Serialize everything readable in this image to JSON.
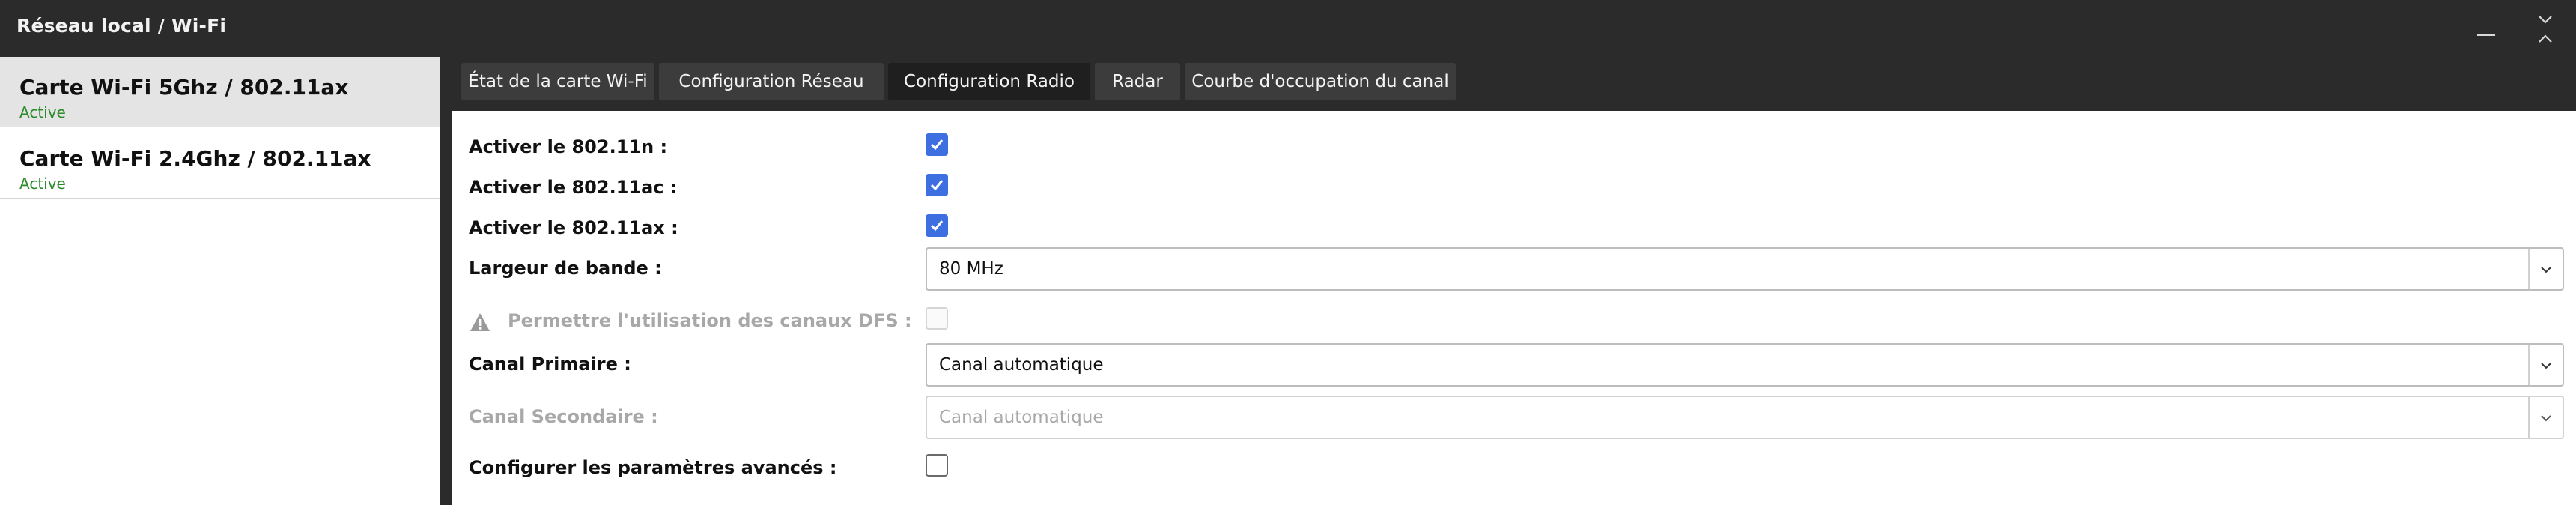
{
  "window": {
    "title": "Réseau local / Wi-Fi",
    "minimize_icon": "minimize-icon",
    "collapse_icon": "collapse-chevrons-icon"
  },
  "sidebar": {
    "items": [
      {
        "name": "Carte Wi-Fi 5Ghz / 802.11ax",
        "status": "Active",
        "selected": true
      },
      {
        "name": "Carte Wi-Fi 2.4Ghz / 802.11ax",
        "status": "Active",
        "selected": false
      }
    ]
  },
  "tabs": [
    {
      "label": "État de la carte Wi-Fi",
      "active": false
    },
    {
      "label": "Configuration Réseau",
      "active": false
    },
    {
      "label": "Configuration Radio",
      "active": true
    },
    {
      "label": "Radar",
      "active": false
    },
    {
      "label": "Courbe d'occupation du canal",
      "active": false
    }
  ],
  "form": {
    "enable_80211n": {
      "label": "Activer le 802.11n :",
      "checked": true
    },
    "enable_80211ac": {
      "label": "Activer le 802.11ac :",
      "checked": true
    },
    "enable_80211ax": {
      "label": "Activer le 802.11ax :",
      "checked": true
    },
    "bandwidth": {
      "label": "Largeur de bande :",
      "value": "80 MHz"
    },
    "dfs": {
      "label": "Permettre l'utilisation des canaux DFS :",
      "checked": false,
      "disabled": true,
      "icon": "warning-icon"
    },
    "primary_channel": {
      "label": "Canal Primaire :",
      "value": "Canal automatique"
    },
    "secondary_channel": {
      "label": "Canal Secondaire :",
      "value": "Canal automatique",
      "disabled": true
    },
    "advanced": {
      "label": "Configurer les paramètres avancés :",
      "checked": false
    }
  },
  "colors": {
    "accent": "#3d6fe0",
    "status_active": "#2a8a2a",
    "chrome_dark": "#2b2b2b"
  }
}
